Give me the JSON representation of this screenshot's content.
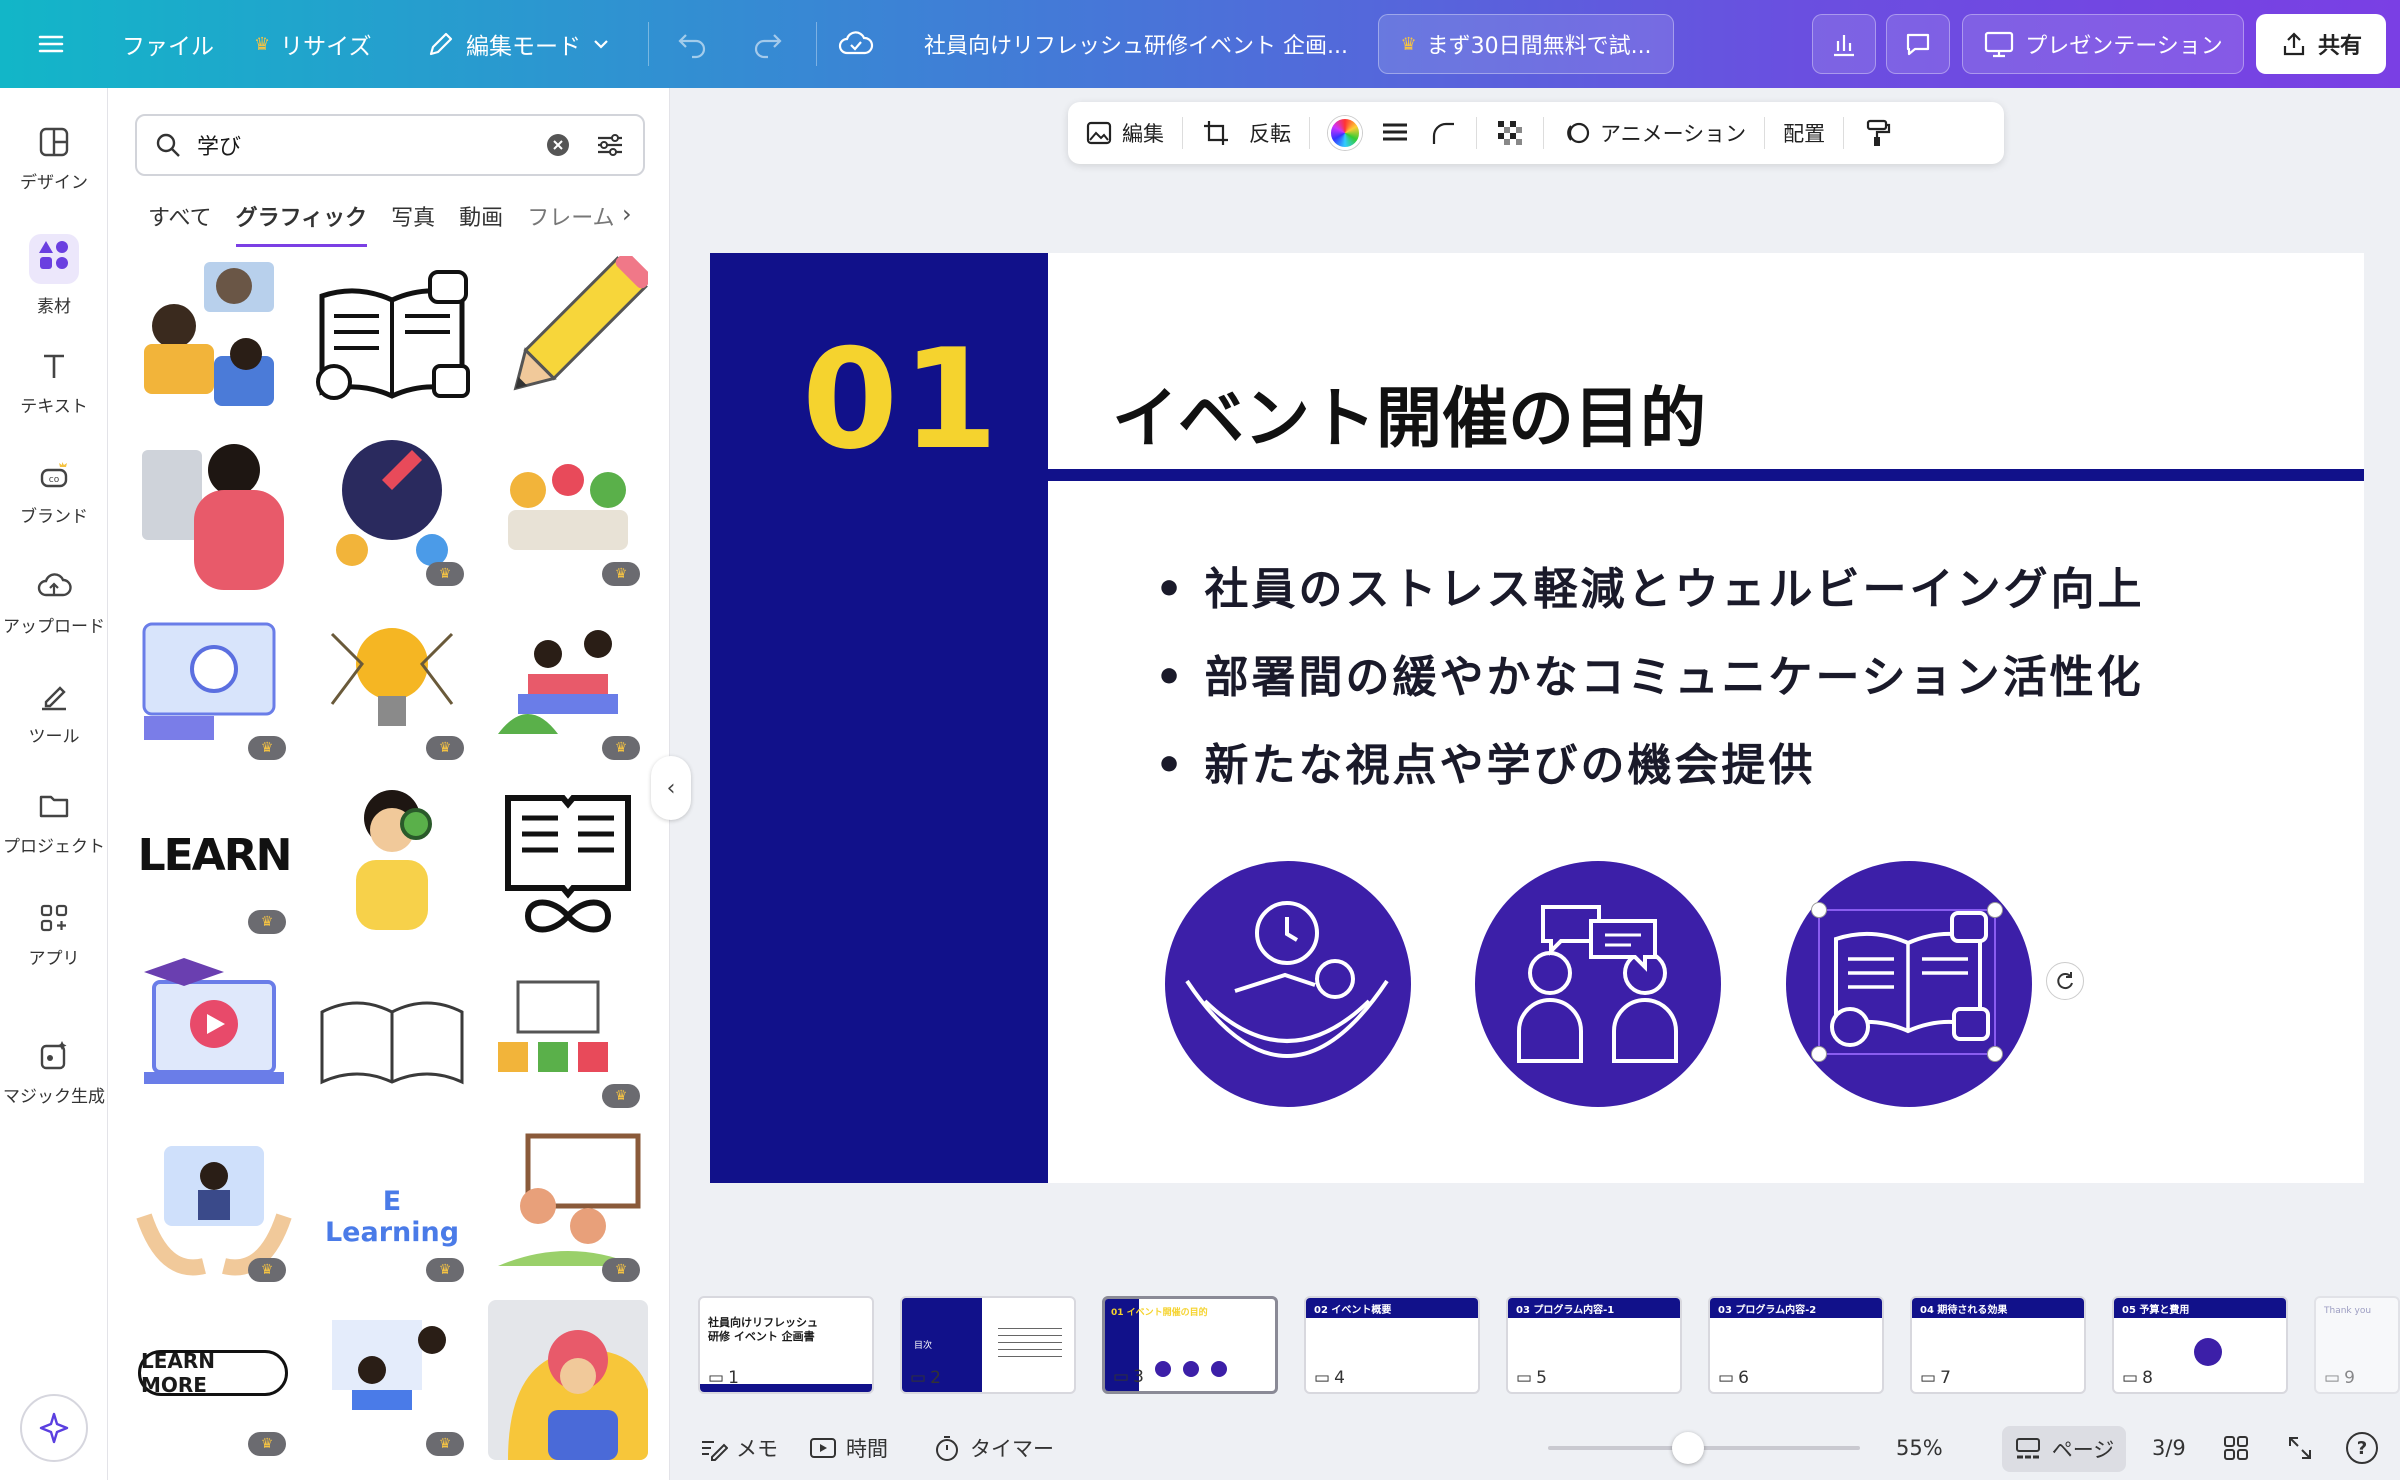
{
  "topbar": {
    "menu_icon": "hamburger-icon",
    "file": "ファイル",
    "resize": "リサイズ",
    "edit_mode": "編集モード",
    "doc_title": "社員向けリフレッシュ研修イベント 企画...",
    "trial": "まず30日間無料で試...",
    "present": "プレゼンテーション",
    "share": "共有"
  },
  "sidebar": {
    "items": [
      {
        "label": "デザイン",
        "icon": "design-icon"
      },
      {
        "label": "素材",
        "icon": "elements-icon"
      },
      {
        "label": "テキスト",
        "icon": "text-icon"
      },
      {
        "label": "ブランド",
        "icon": "brand-icon"
      },
      {
        "label": "アップロード",
        "icon": "upload-icon"
      },
      {
        "label": "ツール",
        "icon": "tools-icon"
      },
      {
        "label": "プロジェクト",
        "icon": "folder-icon"
      },
      {
        "label": "アプリ",
        "icon": "apps-icon"
      },
      {
        "label": "マジック生成",
        "icon": "magic-icon"
      }
    ]
  },
  "panel": {
    "search_value": "学び",
    "tabs": [
      "すべて",
      "グラフィック",
      "写真",
      "動画",
      "フレーム"
    ],
    "grid_texts": {
      "learn": "LEARN",
      "elearning": "E Learning",
      "learn_more": "LEARN MORE"
    }
  },
  "context_toolbar": {
    "edit": "編集",
    "flip": "反転",
    "animation": "アニメーション",
    "position": "配置"
  },
  "slide": {
    "number": "01",
    "title": "イベント開催の目的",
    "bullets": [
      "社員のストレス軽減とウェルビーイング向上",
      "部署間の緩やかなコミュニケーション活性化",
      "新たな視点や学びの機会提供"
    ]
  },
  "thumbnails": [
    {
      "page": "1",
      "heading": "社員向けリフレッシュ研修 イベント 企画書"
    },
    {
      "page": "2",
      "heading": "目次"
    },
    {
      "page": "3",
      "heading": "01 イベント開催の目的"
    },
    {
      "page": "4",
      "heading": "02 イベント概要"
    },
    {
      "page": "5",
      "heading": "03 プログラム内容-1"
    },
    {
      "page": "6",
      "heading": "03 プログラム内容-2"
    },
    {
      "page": "7",
      "heading": "04 期待される効果"
    },
    {
      "page": "8",
      "heading": "05 予算と費用"
    },
    {
      "page": "9",
      "heading": "Thank you"
    }
  ],
  "bottombar": {
    "memo": "メモ",
    "time": "時間",
    "timer": "タイマー",
    "zoom": "55%",
    "page_btn": "ページ",
    "page_count": "3/9",
    "help": "?"
  }
}
